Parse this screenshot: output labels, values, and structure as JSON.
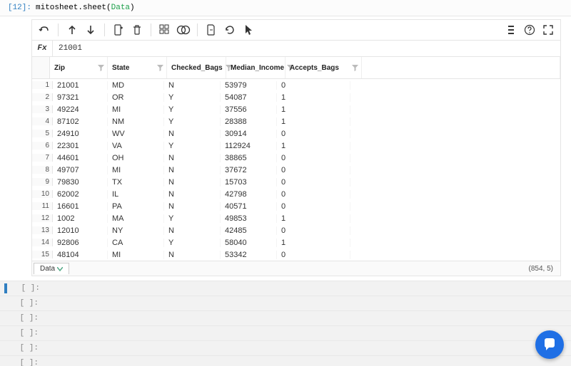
{
  "cell": {
    "prompt": "[12]:",
    "code_prefix": "mitosheet.sheet(",
    "code_arg": "Data",
    "code_suffix": ")"
  },
  "formula": {
    "label": "Fx",
    "value": "21001"
  },
  "columns": {
    "zip": "Zip",
    "state": "State",
    "checked": "Checked_Bags",
    "income": "Median_Income",
    "accepts": "Accepts_Bags"
  },
  "rows": [
    {
      "n": "1",
      "zip": "21001",
      "state": "MD",
      "chk": "N",
      "inc": "53979",
      "acc": "0"
    },
    {
      "n": "2",
      "zip": "97321",
      "state": "OR",
      "chk": "Y",
      "inc": "54087",
      "acc": "1"
    },
    {
      "n": "3",
      "zip": "49224",
      "state": "MI",
      "chk": "Y",
      "inc": "37556",
      "acc": "1"
    },
    {
      "n": "4",
      "zip": "87102",
      "state": "NM",
      "chk": "Y",
      "inc": "28388",
      "acc": "1"
    },
    {
      "n": "5",
      "zip": "24910",
      "state": "WV",
      "chk": "N",
      "inc": "30914",
      "acc": "0"
    },
    {
      "n": "6",
      "zip": "22301",
      "state": "VA",
      "chk": "Y",
      "inc": "112924",
      "acc": "1"
    },
    {
      "n": "7",
      "zip": "44601",
      "state": "OH",
      "chk": "N",
      "inc": "38865",
      "acc": "0"
    },
    {
      "n": "8",
      "zip": "49707",
      "state": "MI",
      "chk": "N",
      "inc": "37672",
      "acc": "0"
    },
    {
      "n": "9",
      "zip": "79830",
      "state": "TX",
      "chk": "N",
      "inc": "15703",
      "acc": "0"
    },
    {
      "n": "10",
      "zip": "62002",
      "state": "IL",
      "chk": "N",
      "inc": "42798",
      "acc": "0"
    },
    {
      "n": "11",
      "zip": "16601",
      "state": "PA",
      "chk": "N",
      "inc": "40571",
      "acc": "0"
    },
    {
      "n": "12",
      "zip": "1002",
      "state": "MA",
      "chk": "Y",
      "inc": "49853",
      "acc": "1"
    },
    {
      "n": "13",
      "zip": "12010",
      "state": "NY",
      "chk": "N",
      "inc": "42485",
      "acc": "0"
    },
    {
      "n": "14",
      "zip": "92806",
      "state": "CA",
      "chk": "Y",
      "inc": "58040",
      "acc": "1"
    },
    {
      "n": "15",
      "zip": "48104",
      "state": "MI",
      "chk": "N",
      "inc": "53342",
      "acc": "0"
    }
  ],
  "footer": {
    "tab": "Data",
    "dims": "(854, 5)"
  },
  "empty_prompt": "[ ]:",
  "icons": {
    "undo": "undo-icon",
    "import_up": "arrow-up-icon",
    "export_down": "arrow-down-icon",
    "add_col": "add-column-icon",
    "del_col": "trash-icon",
    "pivot": "pivot-icon",
    "merge": "merge-icon",
    "save": "save-icon",
    "replay": "refresh-icon",
    "cursor": "cursor-icon",
    "steps": "steps-icon",
    "help": "help-icon",
    "fullscreen": "fullscreen-icon"
  }
}
